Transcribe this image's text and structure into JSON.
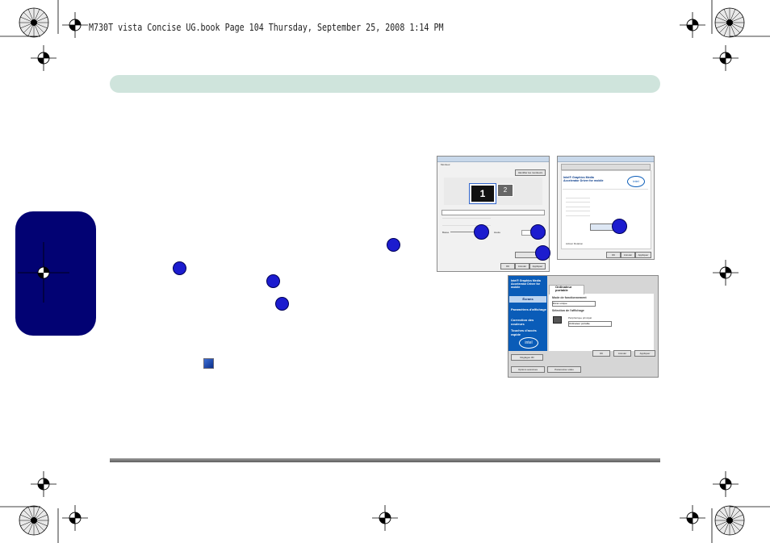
{
  "header": {
    "running_head": "M730T vista Concise UG.book  Page 104  Thursday, September 25, 2008  1:14 PM"
  },
  "screenshot_windows": {
    "tab_label": "Moniteur",
    "identify_button": "Identifier les moniteurs",
    "monitor_1": "1",
    "monitor_2": "2",
    "resolution_low": "Basse",
    "resolution_high": "Haute",
    "ok_button": "OK",
    "cancel_button": "Annuler",
    "apply_button": "Appliquer",
    "intel_brand": "Intel® Graphics Media Accelerator Driver for mobile",
    "intel_logo": "intel",
    "rotation_label": "Activer Rotation"
  },
  "screenshot_intel": {
    "left_title": "Intel® Graphics Media Accelerator Driver for mobile",
    "menu_items": [
      "Écrans",
      "Paramètres d'affichage",
      "Correction des couleurs",
      "Touches d'accès rapide"
    ],
    "device_title": "Ordinateur portable",
    "mode_heading": "Mode de fonctionnement",
    "mode_value": "Écran unique",
    "display_heading": "Sélection de l'affichage",
    "display_option": "Périphérique principal",
    "display_value": "Ordinateur portable",
    "ok_button": "OK",
    "cancel_button": "Annuler",
    "apply_button": "Appliquer",
    "settings_3d_button": "Réglages 3D",
    "advanced_options_button": "Options avancées",
    "video_settings_button": "Paramètres vidéo",
    "logo": "intel"
  },
  "colors": {
    "banner": "#cfe4dc",
    "side_tab": "#020273",
    "badge": "#1c1ccf",
    "intel_blue": "#0a5cb8"
  }
}
